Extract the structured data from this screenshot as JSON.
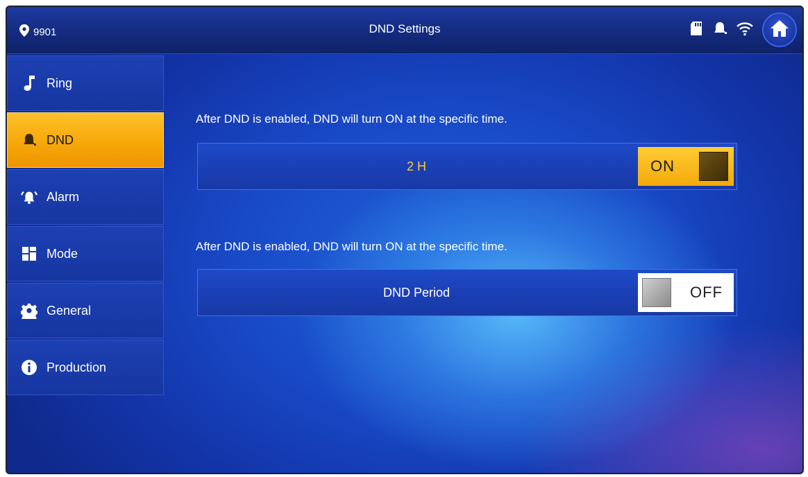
{
  "header": {
    "location_number": "9901",
    "title": "DND Settings",
    "icons": [
      "location-pin-icon",
      "sd-card-icon",
      "bell-icon",
      "wifi-icon",
      "home-icon"
    ]
  },
  "sidebar": {
    "items": [
      {
        "label": "Ring",
        "icon": "music-note-icon",
        "active": false
      },
      {
        "label": "DND",
        "icon": "bell-icon",
        "active": true
      },
      {
        "label": "Alarm",
        "icon": "alarm-icon",
        "active": false
      },
      {
        "label": "Mode",
        "icon": "grid-icon",
        "active": false
      },
      {
        "label": "General",
        "icon": "gear-icon",
        "active": false
      },
      {
        "label": "Production",
        "icon": "info-icon",
        "active": false
      }
    ]
  },
  "main": {
    "sections": [
      {
        "description": "After DND is enabled, DND will turn ON at the specific time.",
        "row_label": "2 H",
        "toggle_label": "ON",
        "toggle_state": "on"
      },
      {
        "description": "After DND is enabled, DND will turn ON at the specific time.",
        "row_label": "DND Period",
        "toggle_label": "OFF",
        "toggle_state": "off"
      }
    ]
  },
  "colors": {
    "accent": "#f6a80a",
    "highlight_text": "#ffcc33",
    "panel": "#1b3fb4"
  }
}
